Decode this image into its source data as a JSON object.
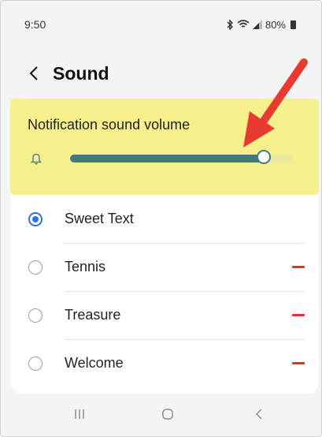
{
  "status_bar": {
    "time": "9:50",
    "icons": [
      "bluetooth-icon",
      "wifi-icon",
      "signal-icon"
    ],
    "battery": "80%"
  },
  "header": {
    "back_icon": "chevron-left-icon",
    "title": "Sound"
  },
  "notification_volume": {
    "label": "Notification sound volume",
    "icon": "bell-icon",
    "level": 0.87,
    "highlight_color": "#f6f08c",
    "accent_color": "#3e7a7e"
  },
  "sounds": [
    {
      "label": "Sweet Text",
      "selected": true,
      "removable": false
    },
    {
      "label": "Tennis",
      "selected": false,
      "removable": true
    },
    {
      "label": "Treasure",
      "selected": false,
      "removable": true
    },
    {
      "label": "Welcome",
      "selected": false,
      "removable": true
    }
  ],
  "nav_bar": {
    "buttons": [
      "recent-apps-icon",
      "home-icon",
      "back-icon"
    ]
  },
  "annotation": {
    "arrow_color": "#e83a2f"
  }
}
